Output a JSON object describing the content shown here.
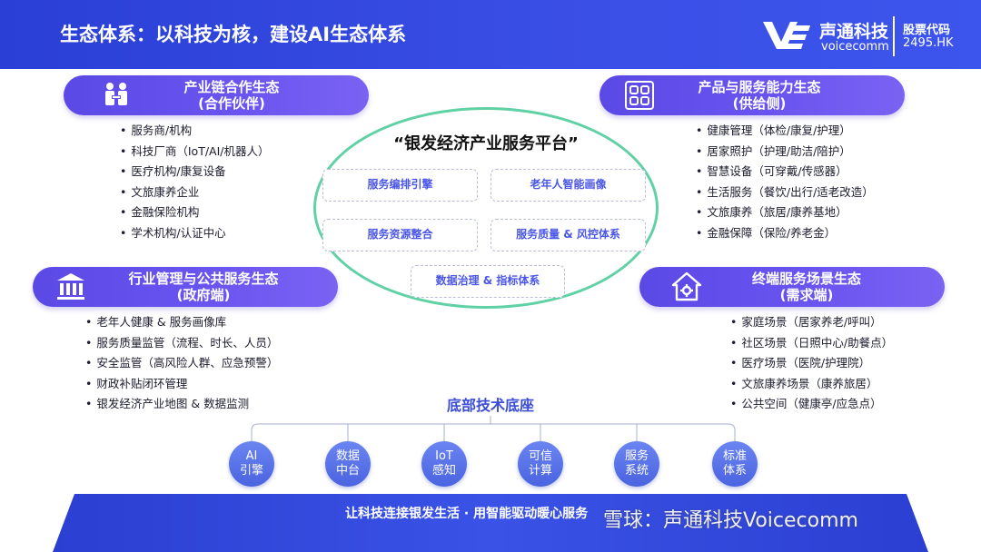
{
  "header": {
    "title": "生态体系：以科技为核，建设AI生态体系",
    "logo_cn": "声通科技",
    "logo_en": "voicecomm",
    "stock_label": "股票代码",
    "stock_code": "2495.HK"
  },
  "partners": {
    "title": "产业链合作生态",
    "subtitle": "(合作伙伴)",
    "icon": "handshake-people-icon",
    "items": [
      "服务商/机构",
      "科技厂商（IoT/AI/机器人）",
      "医疗机构/康复设备",
      "文旅康养企业",
      "金融保险机构",
      "学术机构/认证中心"
    ]
  },
  "supply": {
    "title": "产品与服务能力生态",
    "subtitle": "(供给侧)",
    "icon": "grid-icon",
    "items": [
      "健康管理（体检/康复/护理）",
      "居家照护（护理/助洁/陪护）",
      "智慧设备（可穿戴/传感器）",
      "生活服务（餐饮/出行/适老改造）",
      "文旅康养（旅居/康养基地）",
      "金融保障（保险/养老金）"
    ]
  },
  "government": {
    "title": "行业管理与公共服务生态",
    "subtitle": "(政府端)",
    "icon": "government-building-icon",
    "items": [
      "老年人健康 & 服务画像库",
      "服务质量监管（流程、时长、人员）",
      "安全监管（高风险人群、应急预警）",
      "财政补贴闭环管理",
      "银发经济产业地图 & 数据监测"
    ]
  },
  "demand": {
    "title": "终端服务场景生态",
    "subtitle": "(需求端)",
    "icon": "home-gear-icon",
    "items": [
      "家庭场景（居家养老/呼叫）",
      "社区场景（日照中心/助餐点）",
      "医疗场景（医院/护理院）",
      "文旅康养场景（康养旅居）",
      "公共空间（健康亭/应急点）"
    ]
  },
  "platform": {
    "title": "“银发经济产业服务平台”",
    "services": [
      "服务编排引擎",
      "老年人智能画像",
      "服务资源整合",
      "服务质量 & 风控体系",
      "数据治理 & 指标体系"
    ]
  },
  "base": {
    "title": "底部技术底座",
    "items": [
      {
        "line1": "AI",
        "line2": "引擎"
      },
      {
        "line1": "数据",
        "line2": "中台"
      },
      {
        "line1": "IoT",
        "line2": "感知"
      },
      {
        "line1": "可信",
        "line2": "计算"
      },
      {
        "line1": "服务",
        "line2": "系统"
      },
      {
        "line1": "标准",
        "line2": "体系"
      }
    ]
  },
  "footer": {
    "slogan": "让科技连接银发生活 · 用智能驱动暖心服务",
    "watermark": "雪球：声通科技Voicecomm"
  },
  "colors": {
    "header_blue": "#2a3fd6",
    "pill_purple": "#5b49e6",
    "ellipse_green": "#5fd1a4",
    "service_text": "#4a56e8",
    "circle_blue": "#4a63e0"
  }
}
